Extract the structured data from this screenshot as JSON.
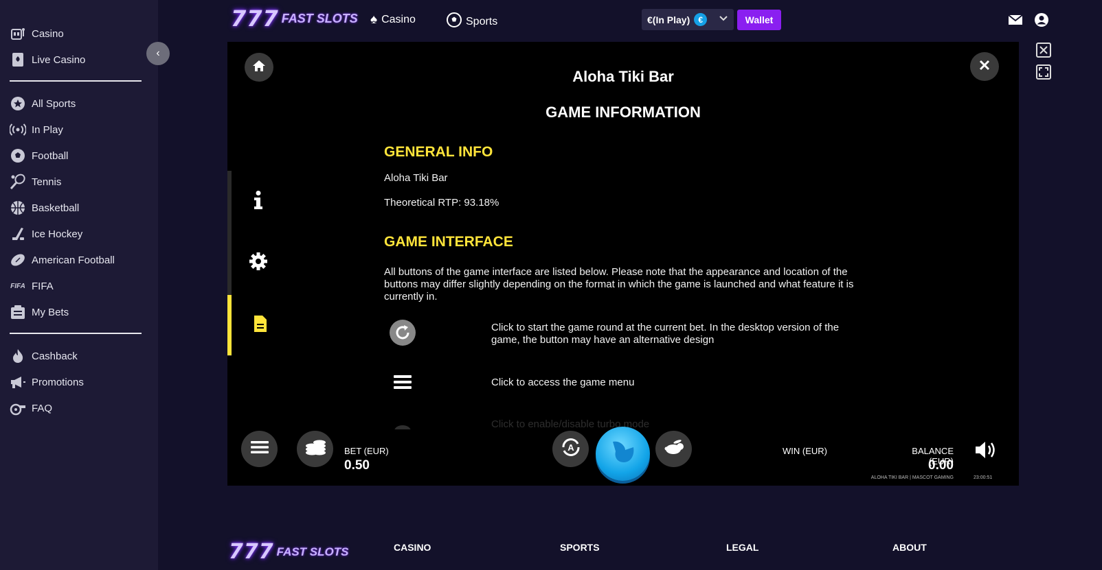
{
  "sidebar": {
    "items_top": [
      {
        "label": "Casino",
        "icon": "slot-machine-icon"
      },
      {
        "label": "Live Casino",
        "icon": "playing-card-icon"
      }
    ],
    "items_sports": [
      {
        "label": "All Sports",
        "icon": "star-badge-icon"
      },
      {
        "label": "In Play",
        "icon": "broadcast-icon"
      },
      {
        "label": "Football",
        "icon": "soccer-ball-icon"
      },
      {
        "label": "Tennis",
        "icon": "tennis-racket-icon"
      },
      {
        "label": "Basketball",
        "icon": "basketball-icon"
      },
      {
        "label": "Ice Hockey",
        "icon": "hockey-stick-icon"
      },
      {
        "label": "American Football",
        "icon": "american-football-icon"
      },
      {
        "label": "FIFA",
        "icon": "fifa-logo-icon"
      },
      {
        "label": "My Bets",
        "icon": "bets-list-icon"
      }
    ],
    "items_bottom": [
      {
        "label": "Cashback",
        "icon": "flame-icon"
      },
      {
        "label": "Promotions",
        "icon": "megaphone-icon"
      },
      {
        "label": "FAQ",
        "icon": "whistle-icon"
      }
    ]
  },
  "header": {
    "logo_number": "777",
    "logo_text": "FAST SLOTS",
    "nav": [
      {
        "label": "Casino",
        "icon": "spade-icon"
      },
      {
        "label": "Sports",
        "icon": "soccer-ball-icon"
      }
    ],
    "balance_label": "€(In Play)",
    "currency_symbol": "€",
    "wallet_label": "Wallet"
  },
  "game": {
    "title": "Aloha Tiki Bar",
    "heading": "GAME INFORMATION",
    "general_info_heading": "GENERAL INFO",
    "game_name": "Aloha Tiki Bar",
    "rtp": "Theoretical RTP: 93.18%",
    "interface_heading": "GAME INTERFACE",
    "interface_intro": "All buttons of the game interface are listed below. Please note that the appearance and location of the buttons may differ slightly depending on the format in which the game is launched and what feature it is currently in.",
    "rows": [
      {
        "icon": "spin-icon",
        "text": "Click to start the game round at the current bet. In the desktop version of the game, the button may have an alternative design"
      },
      {
        "icon": "menu-icon",
        "text": "Click to access the game menu"
      },
      {
        "icon": "rabbit-icon",
        "text": "Click to enable/disable turbo mode"
      }
    ],
    "controls": {
      "bet_label": "BET (EUR)",
      "bet_value": "0.50",
      "win_label": "WIN (EUR)",
      "balance_label": "BALANCE (EUR)",
      "balance_value": "0.00",
      "provider": "ALOHA TIKI BAR | MASCOT GAMING",
      "clock": "23:00:51"
    }
  },
  "footer": {
    "logo_number": "777",
    "logo_text": "FAST SLOTS",
    "columns": [
      "CASINO",
      "SPORTS",
      "LEGAL",
      "ABOUT"
    ]
  },
  "colors": {
    "accent_yellow": "#ffe43a",
    "wallet_purple": "#8a1ff0",
    "spin_blue": "#12a4e8",
    "sidebar_bg": "#1d1a35"
  }
}
